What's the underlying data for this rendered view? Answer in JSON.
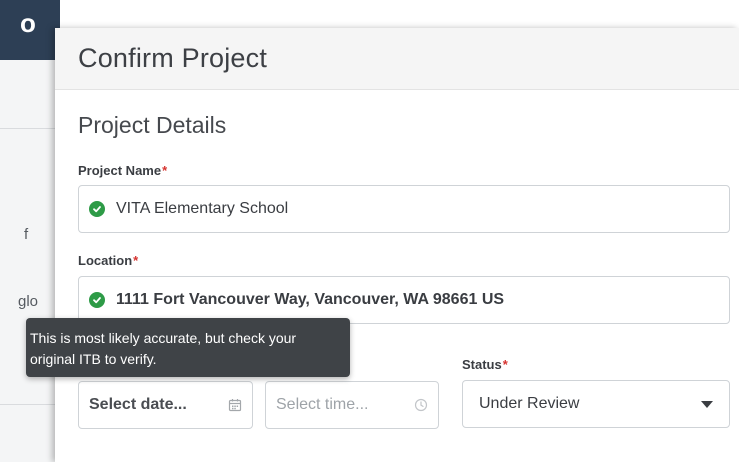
{
  "background": {
    "logo_fragment": "o",
    "text_fragment_1": "f",
    "text_fragment_2": "glo"
  },
  "modal": {
    "title": "Confirm Project",
    "section_title": "Project Details",
    "project_name": {
      "label": "Project Name",
      "required_marker": "*",
      "value": "VITA Elementary School"
    },
    "location": {
      "label": "Location",
      "required_marker": "*",
      "value": "1111 Fort Vancouver Way, Vancouver, WA 98661 US"
    },
    "date": {
      "placeholder": "Select date..."
    },
    "time": {
      "placeholder": "Select time..."
    },
    "status": {
      "label": "Status",
      "required_marker": "*",
      "value": "Under Review"
    },
    "tooltip": {
      "line1": "This is most likely accurate, but check your",
      "line2": "original ITB to verify."
    }
  },
  "colors": {
    "check_green": "#2e9b47",
    "required_red": "#d6332f",
    "tooltip_bg": "#3f4347",
    "header_navy": "#2d3f55"
  },
  "icons": {
    "valid": "check-circle-icon",
    "calendar": "calendar-icon",
    "clock": "clock-icon",
    "dropdown": "caret-down-icon"
  }
}
